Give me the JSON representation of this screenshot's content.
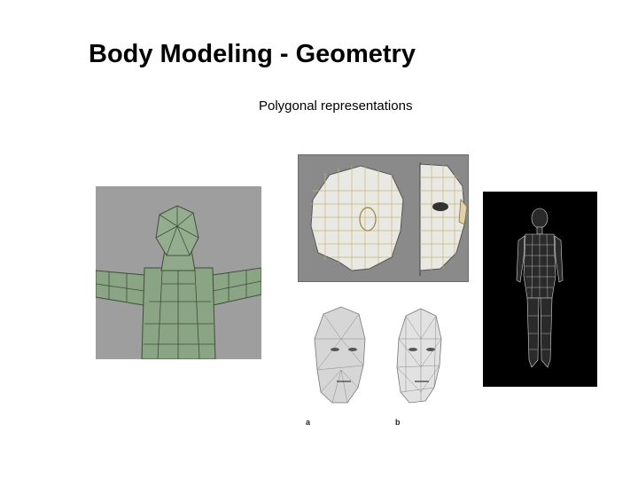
{
  "slide": {
    "title": "Body Modeling - Geometry",
    "subtitle": "Polygonal representations"
  },
  "images": {
    "green_model": {
      "icon": "low-poly-green-torso"
    },
    "mesh_heads": {
      "icon": "wireframe-head-profile-and-front"
    },
    "full_body": {
      "icon": "wireframe-full-body"
    },
    "bw_heads": {
      "icon": "triangulated-head-models",
      "caption_a": "a",
      "caption_b": "b"
    }
  },
  "colors": {
    "green_mesh": "#8aa583",
    "gray_bg": "#9e9e9e",
    "mesh_line": "#d8c79a"
  }
}
